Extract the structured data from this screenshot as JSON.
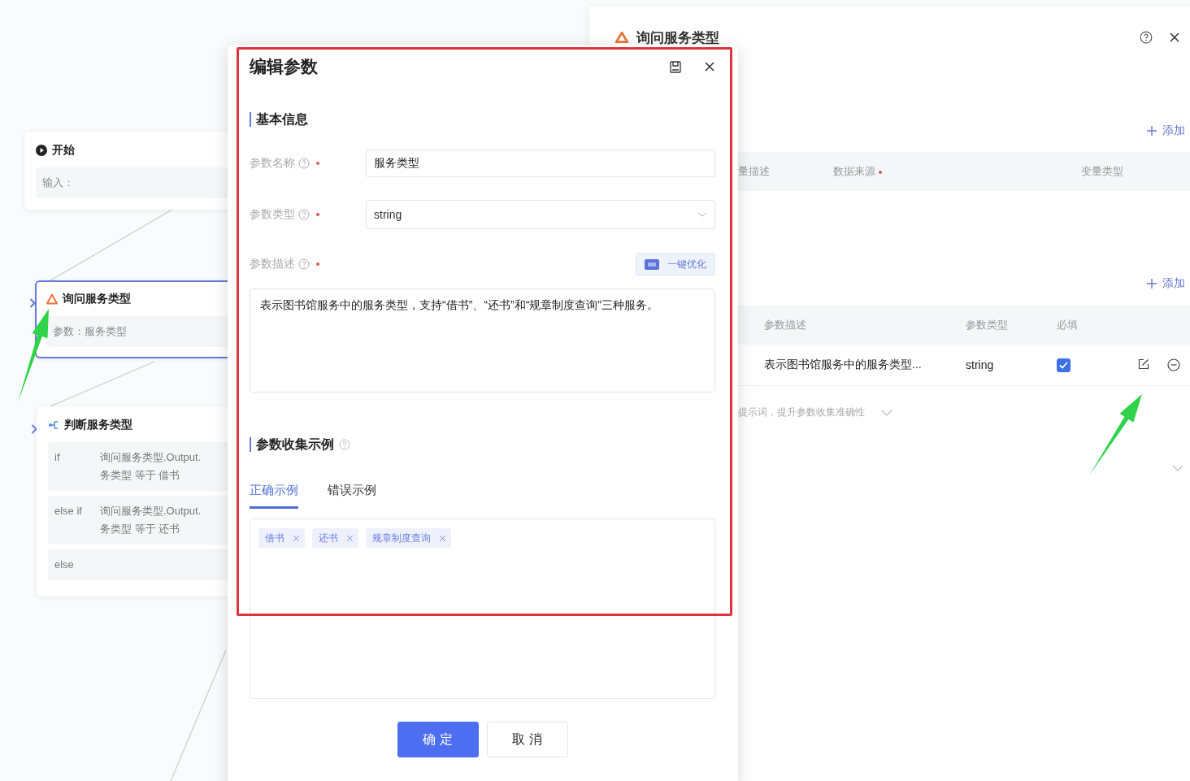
{
  "canvas": {
    "nodes": [
      {
        "kind": "start",
        "title": "开始",
        "selected": false,
        "rows": [
          "输入："
        ]
      },
      {
        "kind": "ask",
        "title": "询问服务类型",
        "selected": true,
        "rows": [
          "参数：服务类型"
        ]
      },
      {
        "kind": "branch",
        "title": "判断服务类型",
        "selected": false,
        "conditions": [
          {
            "keyword": "if",
            "lines": [
              "询问服务类型.Output.",
              "务类型 等于 借书"
            ]
          },
          {
            "keyword": "else if",
            "lines": [
              "询问服务类型.Output.",
              "务类型 等于 还书"
            ]
          },
          {
            "keyword": "else"
          }
        ]
      }
    ]
  },
  "panel": {
    "title": "询问服务类型",
    "sections": [
      {
        "add_label": "添加",
        "columns": [
          {
            "label": "量描述",
            "required": false
          },
          {
            "label": "数据来源",
            "required": true
          },
          {
            "label": "变量类型",
            "required": false
          }
        ]
      },
      {
        "add_label": "添加",
        "columns": [
          {
            "label": "参数描述",
            "required": false
          },
          {
            "label": "参数类型",
            "required": false
          },
          {
            "label": "必填",
            "required": false
          }
        ],
        "rows": [
          {
            "description": "表示图书馆服务中的服务类型...",
            "type": "string",
            "required": true
          }
        ]
      }
    ],
    "hint": "提示词，提升参数收集准确性"
  },
  "dialog": {
    "title": "编辑参数",
    "basic_section": "基本信息",
    "fields": [
      {
        "kind": "input",
        "label": "参数名称",
        "required": true,
        "value": "服务类型"
      },
      {
        "kind": "select",
        "label": "参数类型",
        "required": true,
        "value": "string"
      },
      {
        "kind": "textarea",
        "label": "参数描述",
        "required": true,
        "action": "一键优化",
        "value": "表示图书馆服务中的服务类型，支持“借书”、“还书”和“规章制度查询”三种服务。"
      }
    ],
    "examples_section": "参数收集示例",
    "tabs": [
      {
        "label": "正确示例",
        "selected": true
      },
      {
        "label": "错误示例",
        "selected": false
      }
    ],
    "tags": [
      "借书",
      "还书",
      "规章制度查询"
    ],
    "buttons": [
      {
        "label": "确 定",
        "kind": "primary"
      },
      {
        "label": "取 消",
        "kind": "default"
      }
    ]
  }
}
